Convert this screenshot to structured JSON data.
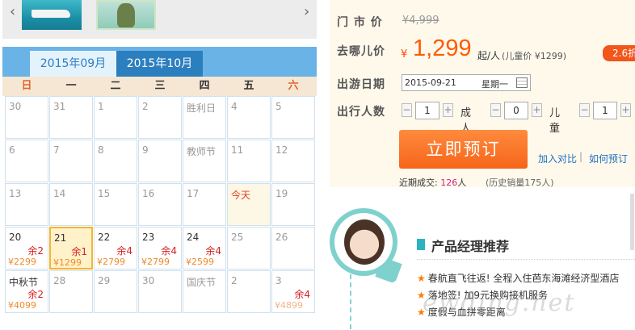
{
  "gallery": {
    "prev_icon": "chevron-left-icon",
    "next_icon": "chevron-right-icon",
    "prev_glyph": "‹",
    "next_glyph": "›"
  },
  "calendar": {
    "tabs": [
      "2015年09月",
      "2015年10月"
    ],
    "weekdays": [
      "日",
      "一",
      "二",
      "三",
      "四",
      "五",
      "六"
    ],
    "weeks": [
      [
        {
          "d": "30"
        },
        {
          "d": "31"
        },
        {
          "d": "1"
        },
        {
          "d": "2"
        },
        {
          "d": "胜利日"
        },
        {
          "d": "4"
        },
        {
          "d": "5"
        }
      ],
      [
        {
          "d": "6"
        },
        {
          "d": "7"
        },
        {
          "d": "8"
        },
        {
          "d": "9"
        },
        {
          "d": "教师节"
        },
        {
          "d": "11"
        },
        {
          "d": "12"
        }
      ],
      [
        {
          "d": "13"
        },
        {
          "d": "14"
        },
        {
          "d": "15"
        },
        {
          "d": "16"
        },
        {
          "d": "17"
        },
        {
          "d": "今天",
          "today": true
        },
        {
          "d": "19"
        }
      ],
      [
        {
          "d": "20",
          "rem": "余2",
          "price": "¥2299",
          "active": true
        },
        {
          "d": "21",
          "rem": "余1",
          "price": "¥1299",
          "active": true,
          "selected": true
        },
        {
          "d": "22",
          "rem": "余4",
          "price": "¥2799",
          "active": true
        },
        {
          "d": "23",
          "rem": "余4",
          "price": "¥2799",
          "active": true
        },
        {
          "d": "24",
          "rem": "余4",
          "price": "¥2599",
          "active": true
        },
        {
          "d": "25"
        },
        {
          "d": "26"
        }
      ],
      [
        {
          "d": "中秋节",
          "rem": "余2",
          "price": "¥4099",
          "active": true
        },
        {
          "d": "28"
        },
        {
          "d": "29"
        },
        {
          "d": "30"
        },
        {
          "d": "国庆节"
        },
        {
          "d": "2"
        },
        {
          "d": "3",
          "rem": "余4",
          "price": "¥4899",
          "faded": true
        }
      ]
    ]
  },
  "booking": {
    "orig_label": "门 市 价",
    "orig_price": "¥4,999",
    "price_label": "去哪儿价",
    "currency": "¥",
    "price": "1,299",
    "per": "起/人",
    "child_price": "(儿童价 ¥1299)",
    "badge": "2.6折",
    "date_label": "出游日期",
    "date_value": "2015-09-21",
    "weekday_value": "星期一",
    "people_label": "出行人数",
    "qty_minus": "−",
    "qty_plus": "+",
    "quantities": [
      {
        "value": "1",
        "unit": "成人"
      },
      {
        "value": "0",
        "unit": "儿童"
      },
      {
        "value": "1",
        "unit": ""
      }
    ],
    "book_button": "立即预订",
    "compare_link": "加入对比",
    "separator": "|",
    "howto_link": "如何预订",
    "recent_label": "近期成交:",
    "recent_count": "126",
    "recent_unit": "人",
    "history": "(历史销量175人)"
  },
  "manager": {
    "title": "产品经理推荐",
    "star": "★",
    "items": [
      "春航直飞往返! 全程入住芭东海滩经济型酒店",
      "落地签! 加9元换购接机服务",
      "度假与血拼零距离"
    ]
  },
  "watermark": "ewding.net"
}
